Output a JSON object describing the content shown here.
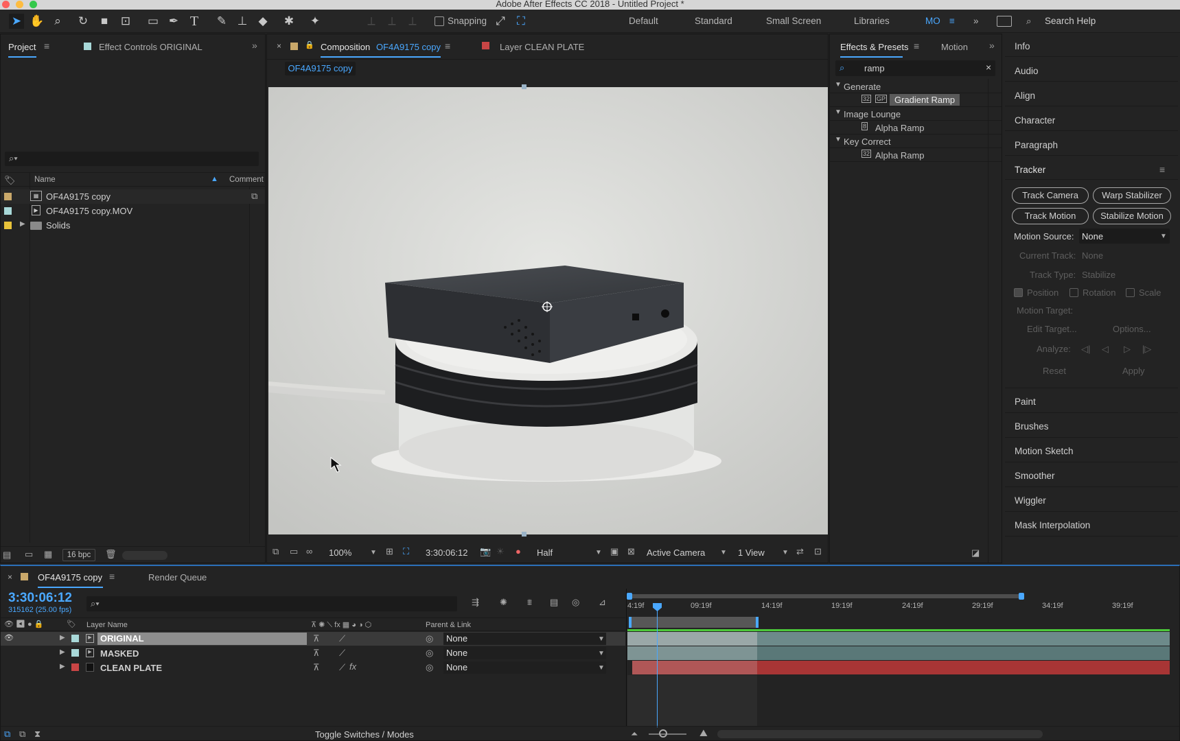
{
  "window": {
    "title": "Adobe After Effects CC 2018 - Untitled Project *"
  },
  "toolbar": {
    "snapping_label": "Snapping",
    "workspaces": [
      "Default",
      "Standard",
      "Small Screen",
      "Libraries"
    ],
    "active_workspace": "MO",
    "search_placeholder": "Search Help"
  },
  "project_panel": {
    "tab_project": "Project",
    "tab_effect_controls": "Effect Controls ORIGINAL",
    "col_name": "Name",
    "col_comment": "Comment",
    "items": [
      {
        "name": "OF4A9175 copy",
        "label_color": "#c9a86a",
        "type": "composition"
      },
      {
        "name": "OF4A9175 copy.MOV",
        "label_color": "#a8d8d8",
        "type": "footage"
      },
      {
        "name": "Solids",
        "label_color": "#e8c23a",
        "type": "folder"
      }
    ],
    "bpc": "16 bpc"
  },
  "composition_panel": {
    "tab_prefix": "Composition",
    "tab_comp_name": "OF4A9175 copy",
    "tab_layer": "Layer CLEAN PLATE",
    "breadcrumb": "OF4A9175 copy",
    "zoom": "100%",
    "timecode": "3:30:06:12",
    "resolution": "Half",
    "camera": "Active Camera",
    "view": "1 View"
  },
  "effects_panel": {
    "tab_effects": "Effects & Presets",
    "tab_motion": "Motion",
    "search_value": "ramp",
    "groups": [
      {
        "name": "Generate",
        "items": [
          "Gradient Ramp"
        ]
      },
      {
        "name": "Image Lounge",
        "items": [
          "Alpha Ramp"
        ]
      },
      {
        "name": "Key Correct",
        "items": [
          "Alpha Ramp"
        ]
      }
    ]
  },
  "right_panel": {
    "items_top": [
      "Info",
      "Audio",
      "Align",
      "Character",
      "Paragraph"
    ],
    "tracker_title": "Tracker",
    "buttons": [
      "Track Camera",
      "Warp Stabilizer",
      "Track Motion",
      "Stabilize Motion"
    ],
    "motion_source_label": "Motion Source:",
    "motion_source_value": "None",
    "current_track_label": "Current Track:",
    "current_track_value": "None",
    "track_type_label": "Track Type:",
    "track_type_value": "Stabilize",
    "position_label": "Position",
    "rotation_label": "Rotation",
    "scale_label": "Scale",
    "motion_target_label": "Motion Target:",
    "edit_target_label": "Edit Target...",
    "options_label": "Options...",
    "analyze_label": "Analyze:",
    "reset_label": "Reset",
    "apply_label": "Apply",
    "items_bottom": [
      "Paint",
      "Brushes",
      "Motion Sketch",
      "Smoother",
      "Wiggler",
      "Mask Interpolation"
    ]
  },
  "timeline": {
    "tab_comp": "OF4A9175 copy",
    "tab_render": "Render Queue",
    "timecode": "3:30:06:12",
    "frame_info": "315162 (25.00 fps)",
    "col_layer_name": "Layer Name",
    "col_parent": "Parent & Link",
    "layers": [
      {
        "name": "ORIGINAL",
        "label_color": "#a8d8d8",
        "parent": "None",
        "selected": true
      },
      {
        "name": "MASKED",
        "label_color": "#a8d8d8",
        "parent": "None",
        "selected": false
      },
      {
        "name": "CLEAN PLATE",
        "label_color": "#c94545",
        "parent": "None",
        "selected": false
      }
    ],
    "ruler_labels": [
      "4:19f",
      "09:19f",
      "14:19f",
      "19:19f",
      "24:19f",
      "29:19f",
      "34:19f",
      "39:19f"
    ],
    "toggle_label": "Toggle Switches / Modes"
  }
}
